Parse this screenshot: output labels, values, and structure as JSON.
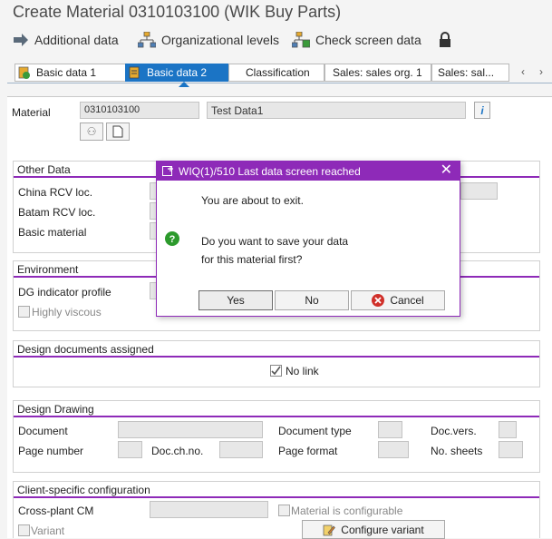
{
  "window": {
    "title": "Create Material 0310103100 (WIK Buy Parts)"
  },
  "toolbar": {
    "additional_data": "Additional data",
    "org_levels": "Organizational levels",
    "check_screen": "Check screen data"
  },
  "tabs": [
    {
      "label": "Basic data 1"
    },
    {
      "label": "Basic data 2"
    },
    {
      "label": "Classification"
    },
    {
      "label": "Sales: sales org. 1"
    },
    {
      "label": "Sales: sal..."
    }
  ],
  "material": {
    "label": "Material",
    "number": "0310103100",
    "description": "Test Data1"
  },
  "other_data": {
    "title": "Other Data",
    "china_rcv": "China RCV loc.",
    "batam_rcv": "Batam RCV loc.",
    "basic_material": "Basic material"
  },
  "environment": {
    "title": "Environment",
    "dg_indicator": "DG indicator profile",
    "highly_viscous": "Highly viscous"
  },
  "design_docs": {
    "title": "Design documents assigned",
    "no_link": "No link"
  },
  "design_drawing": {
    "title": "Design Drawing",
    "document": "Document",
    "document_type": "Document type",
    "doc_vers": "Doc.vers.",
    "page_number": "Page number",
    "doc_ch_no": "Doc.ch.no.",
    "page_format": "Page format",
    "no_sheets": "No. sheets"
  },
  "client_config": {
    "title": "Client-specific configuration",
    "cross_plant": "Cross-plant CM",
    "material_configurable": "Material is configurable",
    "variant": "Variant",
    "configure_variant": "Configure variant"
  },
  "dialog": {
    "title": "WIQ(1)/510 Last data screen reached",
    "line1": "You are about to exit.",
    "line2": "Do you want to save your data",
    "line3": "for this material first?",
    "yes": "Yes",
    "no": "No",
    "cancel": "Cancel"
  },
  "colors": {
    "accent": "#8e2ab8",
    "tab_active": "#1b74c5"
  }
}
